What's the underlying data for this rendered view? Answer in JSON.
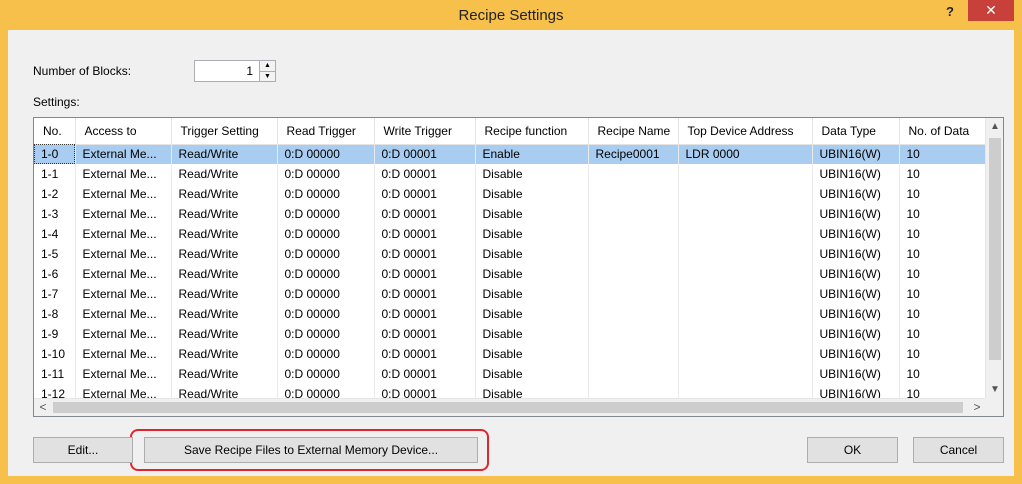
{
  "window": {
    "title": "Recipe Settings",
    "help": "?",
    "close": "✕"
  },
  "blocks": {
    "label": "Number of Blocks:",
    "value": "1",
    "up": "▲",
    "down": "▼"
  },
  "settings": {
    "label": "Settings:"
  },
  "columns": [
    "No.",
    "Access to",
    "Trigger Setting",
    "Read Trigger",
    "Write Trigger",
    "Recipe function",
    "Recipe Name",
    "Top Device Address",
    "Data Type",
    "No. of Data"
  ],
  "rows": [
    [
      "1-0",
      "External Me...",
      "Read/Write",
      "0:D 00000",
      "0:D 00001",
      "Enable",
      "Recipe0001",
      "LDR 0000",
      "UBIN16(W)",
      "10"
    ],
    [
      "1-1",
      "External Me...",
      "Read/Write",
      "0:D 00000",
      "0:D 00001",
      "Disable",
      "",
      "",
      "UBIN16(W)",
      "10"
    ],
    [
      "1-2",
      "External Me...",
      "Read/Write",
      "0:D 00000",
      "0:D 00001",
      "Disable",
      "",
      "",
      "UBIN16(W)",
      "10"
    ],
    [
      "1-3",
      "External Me...",
      "Read/Write",
      "0:D 00000",
      "0:D 00001",
      "Disable",
      "",
      "",
      "UBIN16(W)",
      "10"
    ],
    [
      "1-4",
      "External Me...",
      "Read/Write",
      "0:D 00000",
      "0:D 00001",
      "Disable",
      "",
      "",
      "UBIN16(W)",
      "10"
    ],
    [
      "1-5",
      "External Me...",
      "Read/Write",
      "0:D 00000",
      "0:D 00001",
      "Disable",
      "",
      "",
      "UBIN16(W)",
      "10"
    ],
    [
      "1-6",
      "External Me...",
      "Read/Write",
      "0:D 00000",
      "0:D 00001",
      "Disable",
      "",
      "",
      "UBIN16(W)",
      "10"
    ],
    [
      "1-7",
      "External Me...",
      "Read/Write",
      "0:D 00000",
      "0:D 00001",
      "Disable",
      "",
      "",
      "UBIN16(W)",
      "10"
    ],
    [
      "1-8",
      "External Me...",
      "Read/Write",
      "0:D 00000",
      "0:D 00001",
      "Disable",
      "",
      "",
      "UBIN16(W)",
      "10"
    ],
    [
      "1-9",
      "External Me...",
      "Read/Write",
      "0:D 00000",
      "0:D 00001",
      "Disable",
      "",
      "",
      "UBIN16(W)",
      "10"
    ],
    [
      "1-10",
      "External Me...",
      "Read/Write",
      "0:D 00000",
      "0:D 00001",
      "Disable",
      "",
      "",
      "UBIN16(W)",
      "10"
    ],
    [
      "1-11",
      "External Me...",
      "Read/Write",
      "0:D 00000",
      "0:D 00001",
      "Disable",
      "",
      "",
      "UBIN16(W)",
      "10"
    ],
    [
      "1-12",
      "External Me...",
      "Read/Write",
      "0:D 00000",
      "0:D 00001",
      "Disable",
      "",
      "",
      "UBIN16(W)",
      "10"
    ]
  ],
  "selected_row": 0,
  "scroll": {
    "up": "▲",
    "down": "▼",
    "left": "<",
    "right": ">"
  },
  "buttons": {
    "edit": "Edit...",
    "save": "Save Recipe Files to External Memory Device...",
    "ok": "OK",
    "cancel": "Cancel"
  },
  "colors": {
    "frame": "#f7c04a",
    "close": "#c7403a",
    "selection": "#a8cdf0",
    "highlight": "#e0262c"
  }
}
